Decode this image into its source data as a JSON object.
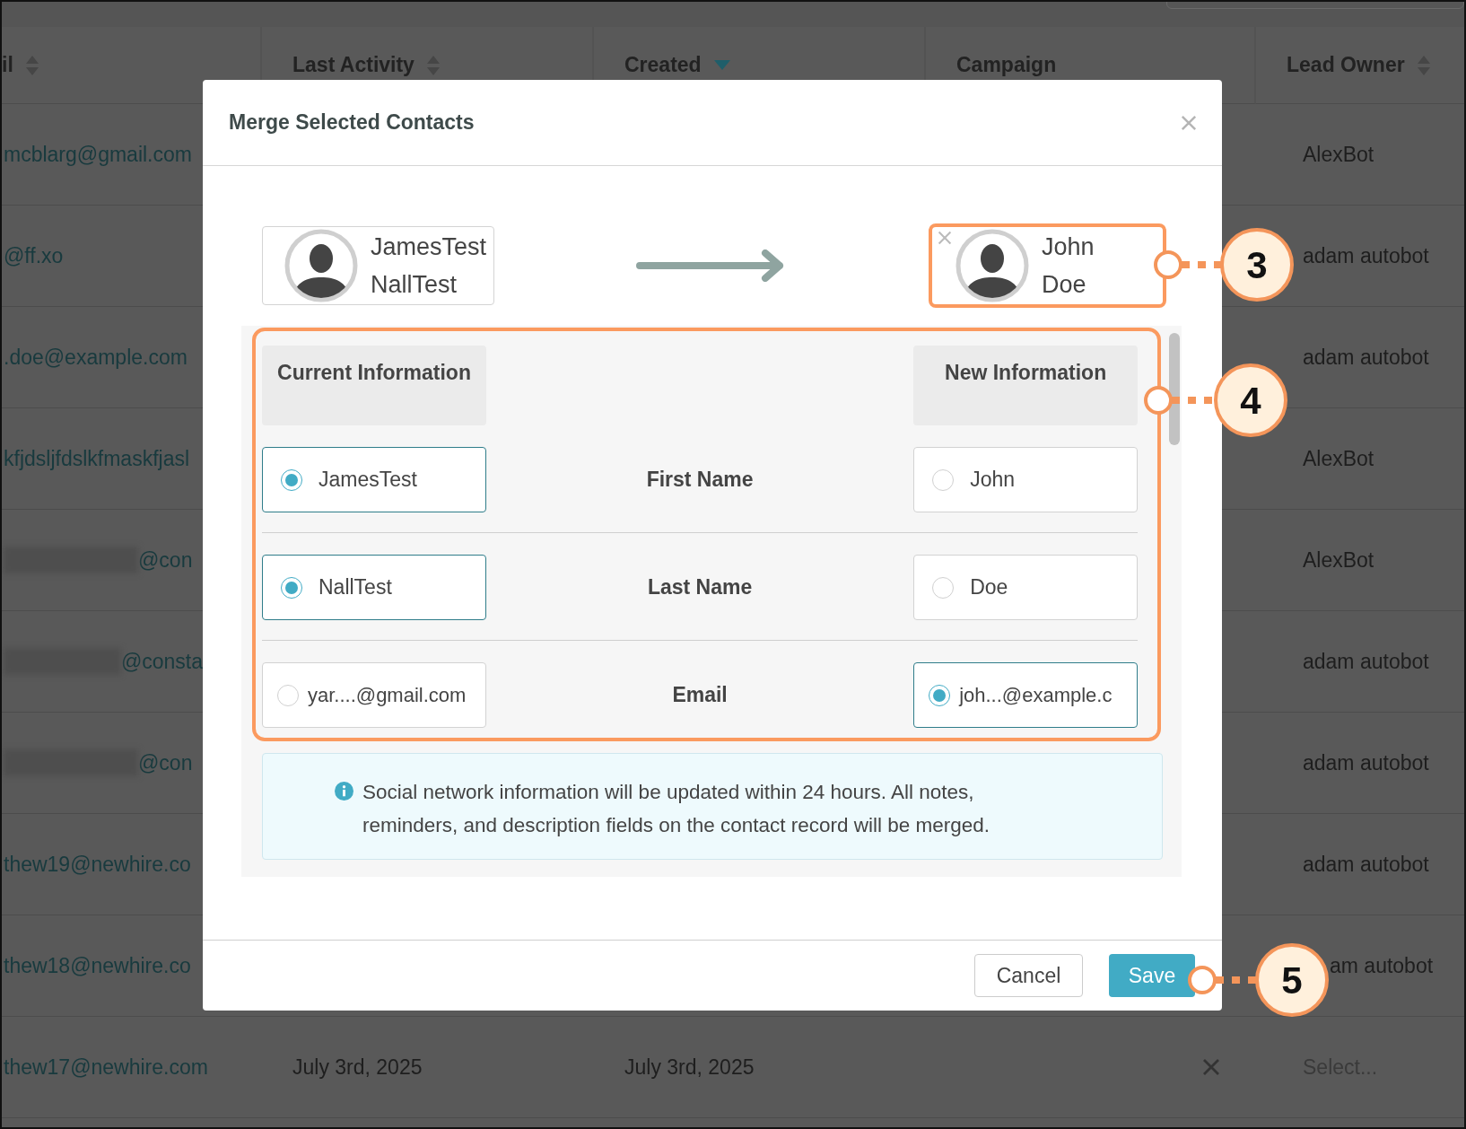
{
  "table": {
    "columns": [
      {
        "label": "il",
        "sortable": true,
        "sorted": false
      },
      {
        "label": "Last Activity",
        "sortable": true,
        "sorted": false
      },
      {
        "label": "Created",
        "sorted": true
      },
      {
        "label": "Campaign",
        "sortable": false,
        "sorted": false
      },
      {
        "label": "Lead Owner",
        "sortable": true,
        "sorted": false
      }
    ],
    "rows": [
      {
        "email": "mcblarg@gmail.com",
        "redacted": false,
        "owner": "AlexBot"
      },
      {
        "email": "@ff.xo",
        "redacted": false,
        "owner": "adam autobot"
      },
      {
        "email": ".doe@example.com",
        "redacted": false,
        "owner": "adam autobot"
      },
      {
        "email": "kfjdsljfdslkfmaskfjasl",
        "redacted": false,
        "owner": "AlexBot"
      },
      {
        "email": "@con",
        "redacted": true,
        "owner": "AlexBot"
      },
      {
        "email": "@consta",
        "redacted": true,
        "owner": "adam autobot"
      },
      {
        "email": "@con",
        "redacted": true,
        "owner": "adam autobot"
      },
      {
        "email": "thew19@newhire.co",
        "redacted": false,
        "owner": "adam autobot"
      },
      {
        "email": "thew18@newhire.co",
        "redacted": false,
        "owner": "am autobot",
        "partly_covered": true
      },
      {
        "email": "thew17@newhire.com",
        "redacted": false,
        "last_activity": "July 3rd, 2025",
        "created": "July 3rd, 2025",
        "campaign_clear": true,
        "owner_placeholder": "Select..."
      }
    ]
  },
  "modal": {
    "title": "Merge Selected Contacts",
    "source": {
      "first_name": "JamesTest",
      "last_name": "NallTest",
      "highlighted": false
    },
    "target": {
      "first_name": "John",
      "last_name": "Doe",
      "highlighted": true
    },
    "compare": {
      "highlighted": true,
      "current_header": "Current Information",
      "new_header": "New Information",
      "rows": [
        {
          "field": "First Name",
          "current": {
            "value": "JamesTest",
            "selected": true
          },
          "new": {
            "value": "John",
            "selected": false
          }
        },
        {
          "field": "Last Name",
          "current": {
            "value": "NallTest",
            "selected": true
          },
          "new": {
            "value": "Doe",
            "selected": false
          }
        },
        {
          "field": "Email",
          "current": {
            "value": "yar....@gmail.com",
            "selected": false
          },
          "new": {
            "value": "joh...@example.c",
            "selected": true
          }
        }
      ]
    },
    "info": "Social network information will be updated within 24 hours. All notes, reminders, and description fields on the contact record will be merged.",
    "buttons": [
      {
        "label": "Cancel",
        "kind": "secondary"
      },
      {
        "label": "Save",
        "kind": "primary"
      }
    ]
  },
  "callouts": [
    {
      "number": "3"
    },
    {
      "number": "4"
    },
    {
      "number": "5"
    }
  ]
}
